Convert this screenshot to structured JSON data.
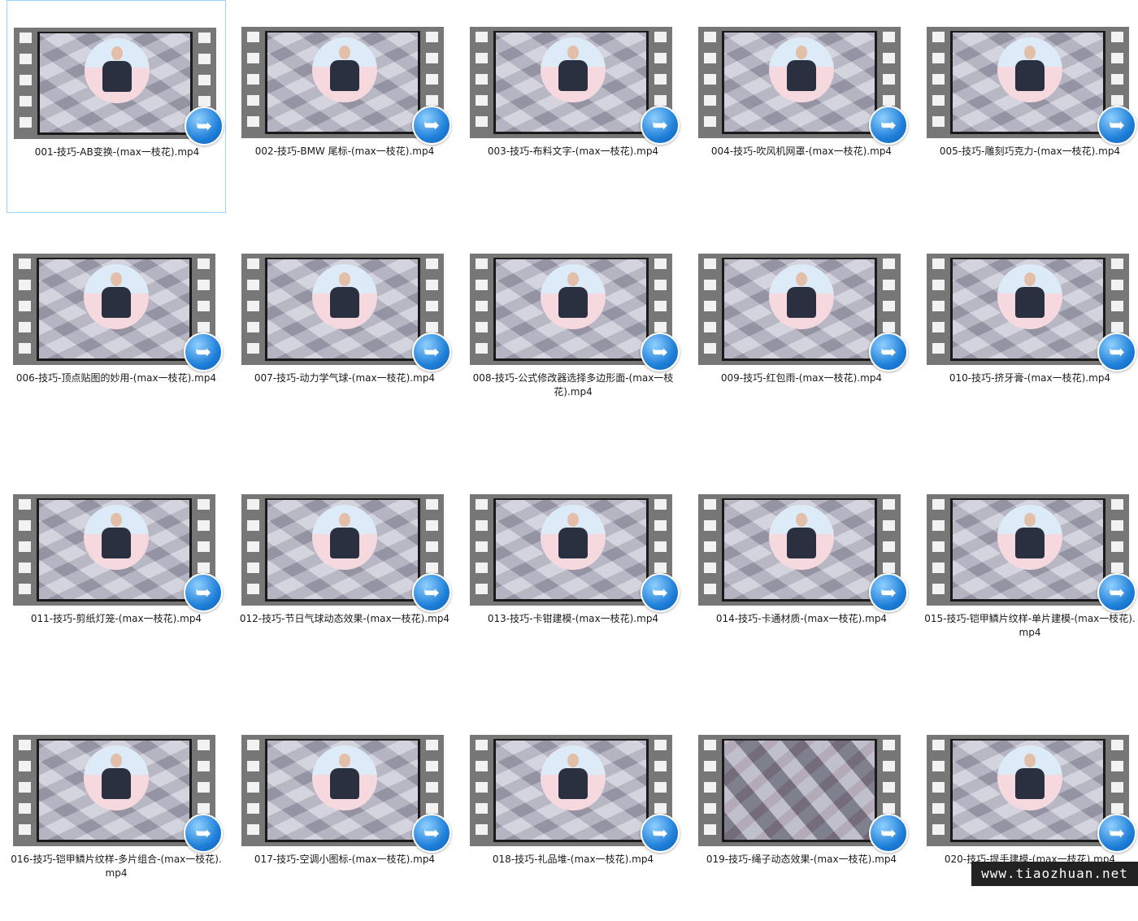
{
  "files": [
    {
      "name": "001-技巧-AB变换-(max一枝花).mp4",
      "selected": true
    },
    {
      "name": "002-技巧-BMW 尾标-(max一枝花).mp4"
    },
    {
      "name": "003-技巧-布料文字-(max一枝花).mp4"
    },
    {
      "name": "004-技巧-吹风机网罩-(max一枝花).mp4"
    },
    {
      "name": "005-技巧-雕刻巧克力-(max一枝花).mp4"
    },
    {
      "name": "006-技巧-顶点贴图的妙用-(max一枝花).mp4"
    },
    {
      "name": "007-技巧-动力学气球-(max一枝花).mp4"
    },
    {
      "name": "008-技巧-公式修改器选择多边形面-(max一枝花).mp4"
    },
    {
      "name": "009-技巧-红包雨-(max一枝花).mp4"
    },
    {
      "name": "010-技巧-挤牙膏-(max一枝花).mp4"
    },
    {
      "name": "011-技巧-剪纸灯笼-(max一枝花).mp4"
    },
    {
      "name": "012-技巧-节日气球动态效果-(max一枝花).mp4"
    },
    {
      "name": "013-技巧-卡钳建模-(max一枝花).mp4"
    },
    {
      "name": "014-技巧-卡通材质-(max一枝花).mp4"
    },
    {
      "name": "015-技巧-铠甲鳞片纹样-单片建模-(max一枝花).mp4"
    },
    {
      "name": "016-技巧-铠甲鳞片纹样-多片组合-(max一枝花).mp4"
    },
    {
      "name": "017-技巧-空调小图标-(max一枝花).mp4"
    },
    {
      "name": "018-技巧-礼品堆-(max一枝花).mp4"
    },
    {
      "name": "019-技巧-绳子动态效果-(max一枝花).mp4",
      "alt_thumb": true
    },
    {
      "name": "020-技巧-提手建模-(max一枝花).mp4"
    }
  ],
  "watermark": "www.tiaozhuan.net",
  "colors": {
    "selection_border": "#99d1ff",
    "film_strip": "#777777",
    "badge": "#1f7fd8"
  },
  "icons": {
    "thumbnail_overlay": "blue-arrow-shortcut-icon"
  }
}
